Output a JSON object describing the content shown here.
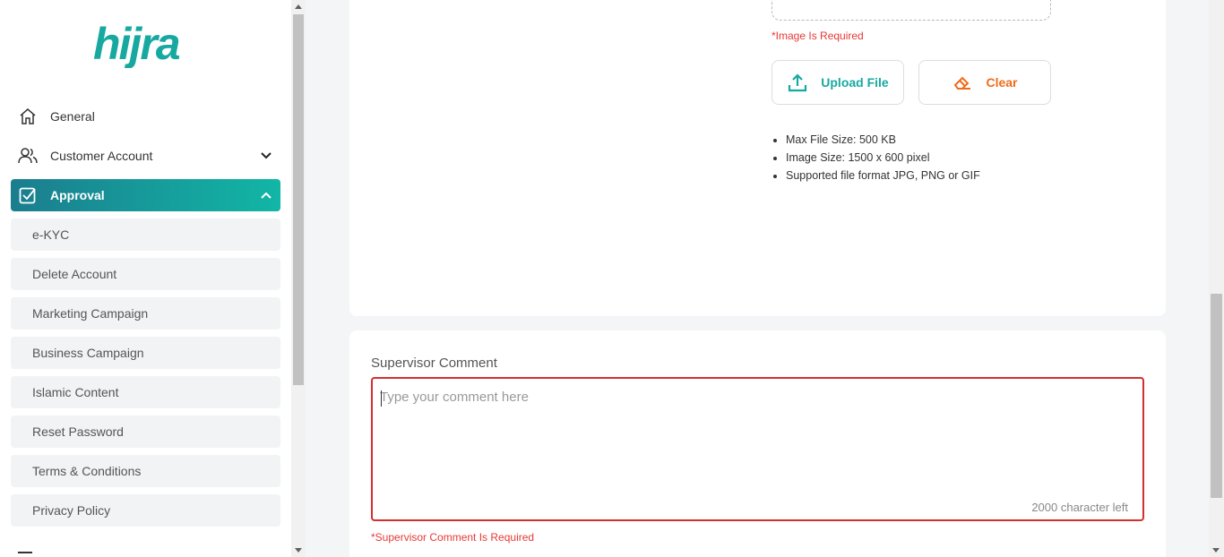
{
  "sidebar": {
    "logo_text": "hijra",
    "top_items": [
      {
        "label": "General",
        "icon": "home-icon"
      },
      {
        "label": "Customer Account",
        "icon": "users-icon"
      }
    ],
    "active_item": {
      "label": "Approval",
      "icon": "check-square-icon"
    },
    "sub_items": [
      "e-KYC",
      "Delete Account",
      "Marketing Campaign",
      "Business Campaign",
      "Islamic Content",
      "Reset Password",
      "Terms & Conditions",
      "Privacy Policy"
    ]
  },
  "upload": {
    "error": "*Image Is Required",
    "upload_label": "Upload File",
    "clear_label": "Clear",
    "rules": [
      "Max File Size: 500 KB",
      "Image Size: 1500 x 600 pixel",
      "Supported file format JPG, PNG or GIF"
    ]
  },
  "comment": {
    "label": "Supervisor Comment",
    "placeholder": "Type your comment here",
    "value": "",
    "counter": "2000 character left",
    "error": "*Supervisor Comment Is Required"
  },
  "colors": {
    "brand_teal": "#17a9a0",
    "active_gradient_start": "#1b7d8e",
    "active_gradient_end": "#12b6a6",
    "clear_orange": "#ef6c1a",
    "error_red": "#e53935"
  }
}
